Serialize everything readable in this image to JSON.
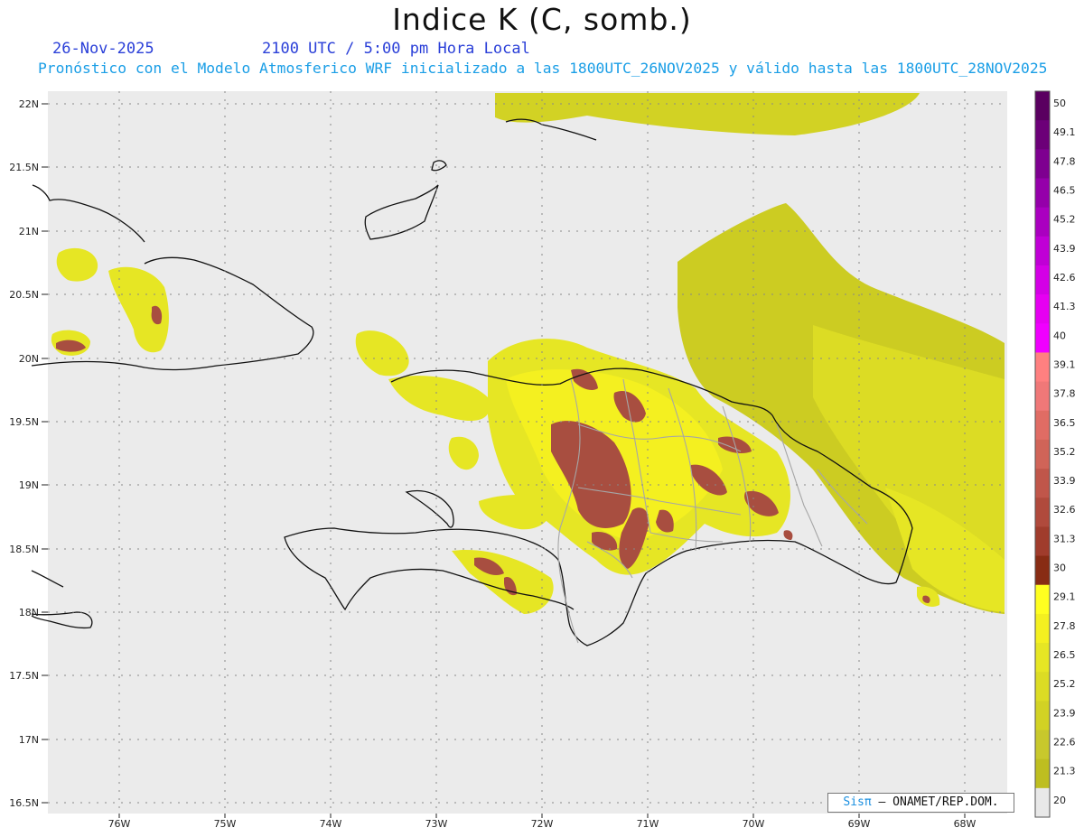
{
  "title": "Indice K (C, somb.)",
  "date": "26-Nov-2025",
  "valid_time": "2100 UTC / 5:00 pm Hora Local",
  "description": "Pronóstico con el Modelo Atmosferico WRF inicializado a las 1800UTC_26NOV2025 y válido hasta las  1800UTC_28NOV2025",
  "credit": {
    "brand": "Sisπ",
    "text": " – ONAMET/REP.DOM."
  },
  "map": {
    "lat_labels": [
      "22N",
      "21.5N",
      "21N",
      "20.5N",
      "20N",
      "19.5N",
      "19N",
      "18.5N",
      "18N",
      "17.5N",
      "17N",
      "16.5N"
    ],
    "lon_labels": [
      "76W",
      "75W",
      "74W",
      "73W",
      "72W",
      "71W",
      "70W",
      "69W",
      "68W"
    ],
    "colorbar": {
      "labels": [
        "50",
        "49.1",
        "47.8",
        "46.5",
        "45.2",
        "43.9",
        "42.6",
        "41.3",
        "40",
        "39.1",
        "37.8",
        "36.5",
        "35.2",
        "33.9",
        "32.6",
        "31.3",
        "30",
        "29.1",
        "27.8",
        "26.5",
        "25.2",
        "23.9",
        "22.6",
        "21.3",
        "20"
      ],
      "colors": [
        "#5a0060",
        "#6c0078",
        "#7e0090",
        "#9500aa",
        "#aa00c0",
        "#c000d6",
        "#d400e6",
        "#e600f2",
        "#f000ff",
        "#ff8080",
        "#f07878",
        "#e06c64",
        "#d06458",
        "#c0564a",
        "#b04a3c",
        "#a03c2c",
        "#882c14",
        "#ffff20",
        "#f4f020",
        "#e6e624",
        "#dcdc24",
        "#d2d224",
        "#c8c82c",
        "#bebe20",
        "#e8e8e8"
      ]
    }
  }
}
